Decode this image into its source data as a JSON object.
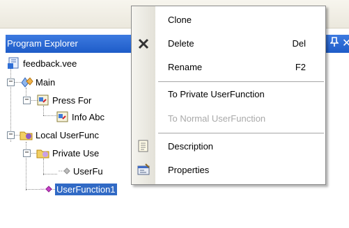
{
  "panel": {
    "title": "Program Explorer",
    "pin_icon": "pin-icon",
    "close_icon": "close-icon"
  },
  "tree": {
    "nodes": [
      {
        "label": "feedback.vee",
        "icon": "program-file-icon"
      },
      {
        "label": "Main",
        "icon": "main-icon"
      },
      {
        "label": "Press For",
        "icon": "panel-object-icon"
      },
      {
        "label": "Info Abc",
        "icon": "panel-object-icon"
      },
      {
        "label": "Local UserFunc",
        "icon": "folder-icon"
      },
      {
        "label": "Private Use",
        "icon": "folder-icon"
      },
      {
        "label": "UserFu",
        "icon": "userfunction-gray-icon"
      },
      {
        "label": "UserFunction1",
        "icon": "userfunction-icon",
        "selected": true
      }
    ]
  },
  "context_menu": {
    "items": [
      {
        "label": "Clone",
        "shortcut": ""
      },
      {
        "label": "Delete",
        "shortcut": "Del",
        "icon": "delete-x-icon"
      },
      {
        "label": "Rename",
        "shortcut": "F2"
      },
      {
        "label": "To Private UserFunction",
        "shortcut": ""
      },
      {
        "label": "To Normal UserFunction",
        "shortcut": "",
        "disabled": true
      },
      {
        "label": "Description",
        "shortcut": "",
        "icon": "description-icon"
      },
      {
        "label": "Properties",
        "shortcut": "",
        "icon": "properties-icon"
      }
    ]
  },
  "colors": {
    "header_blue": "#2a66d4",
    "selection_blue": "#316ac5"
  }
}
